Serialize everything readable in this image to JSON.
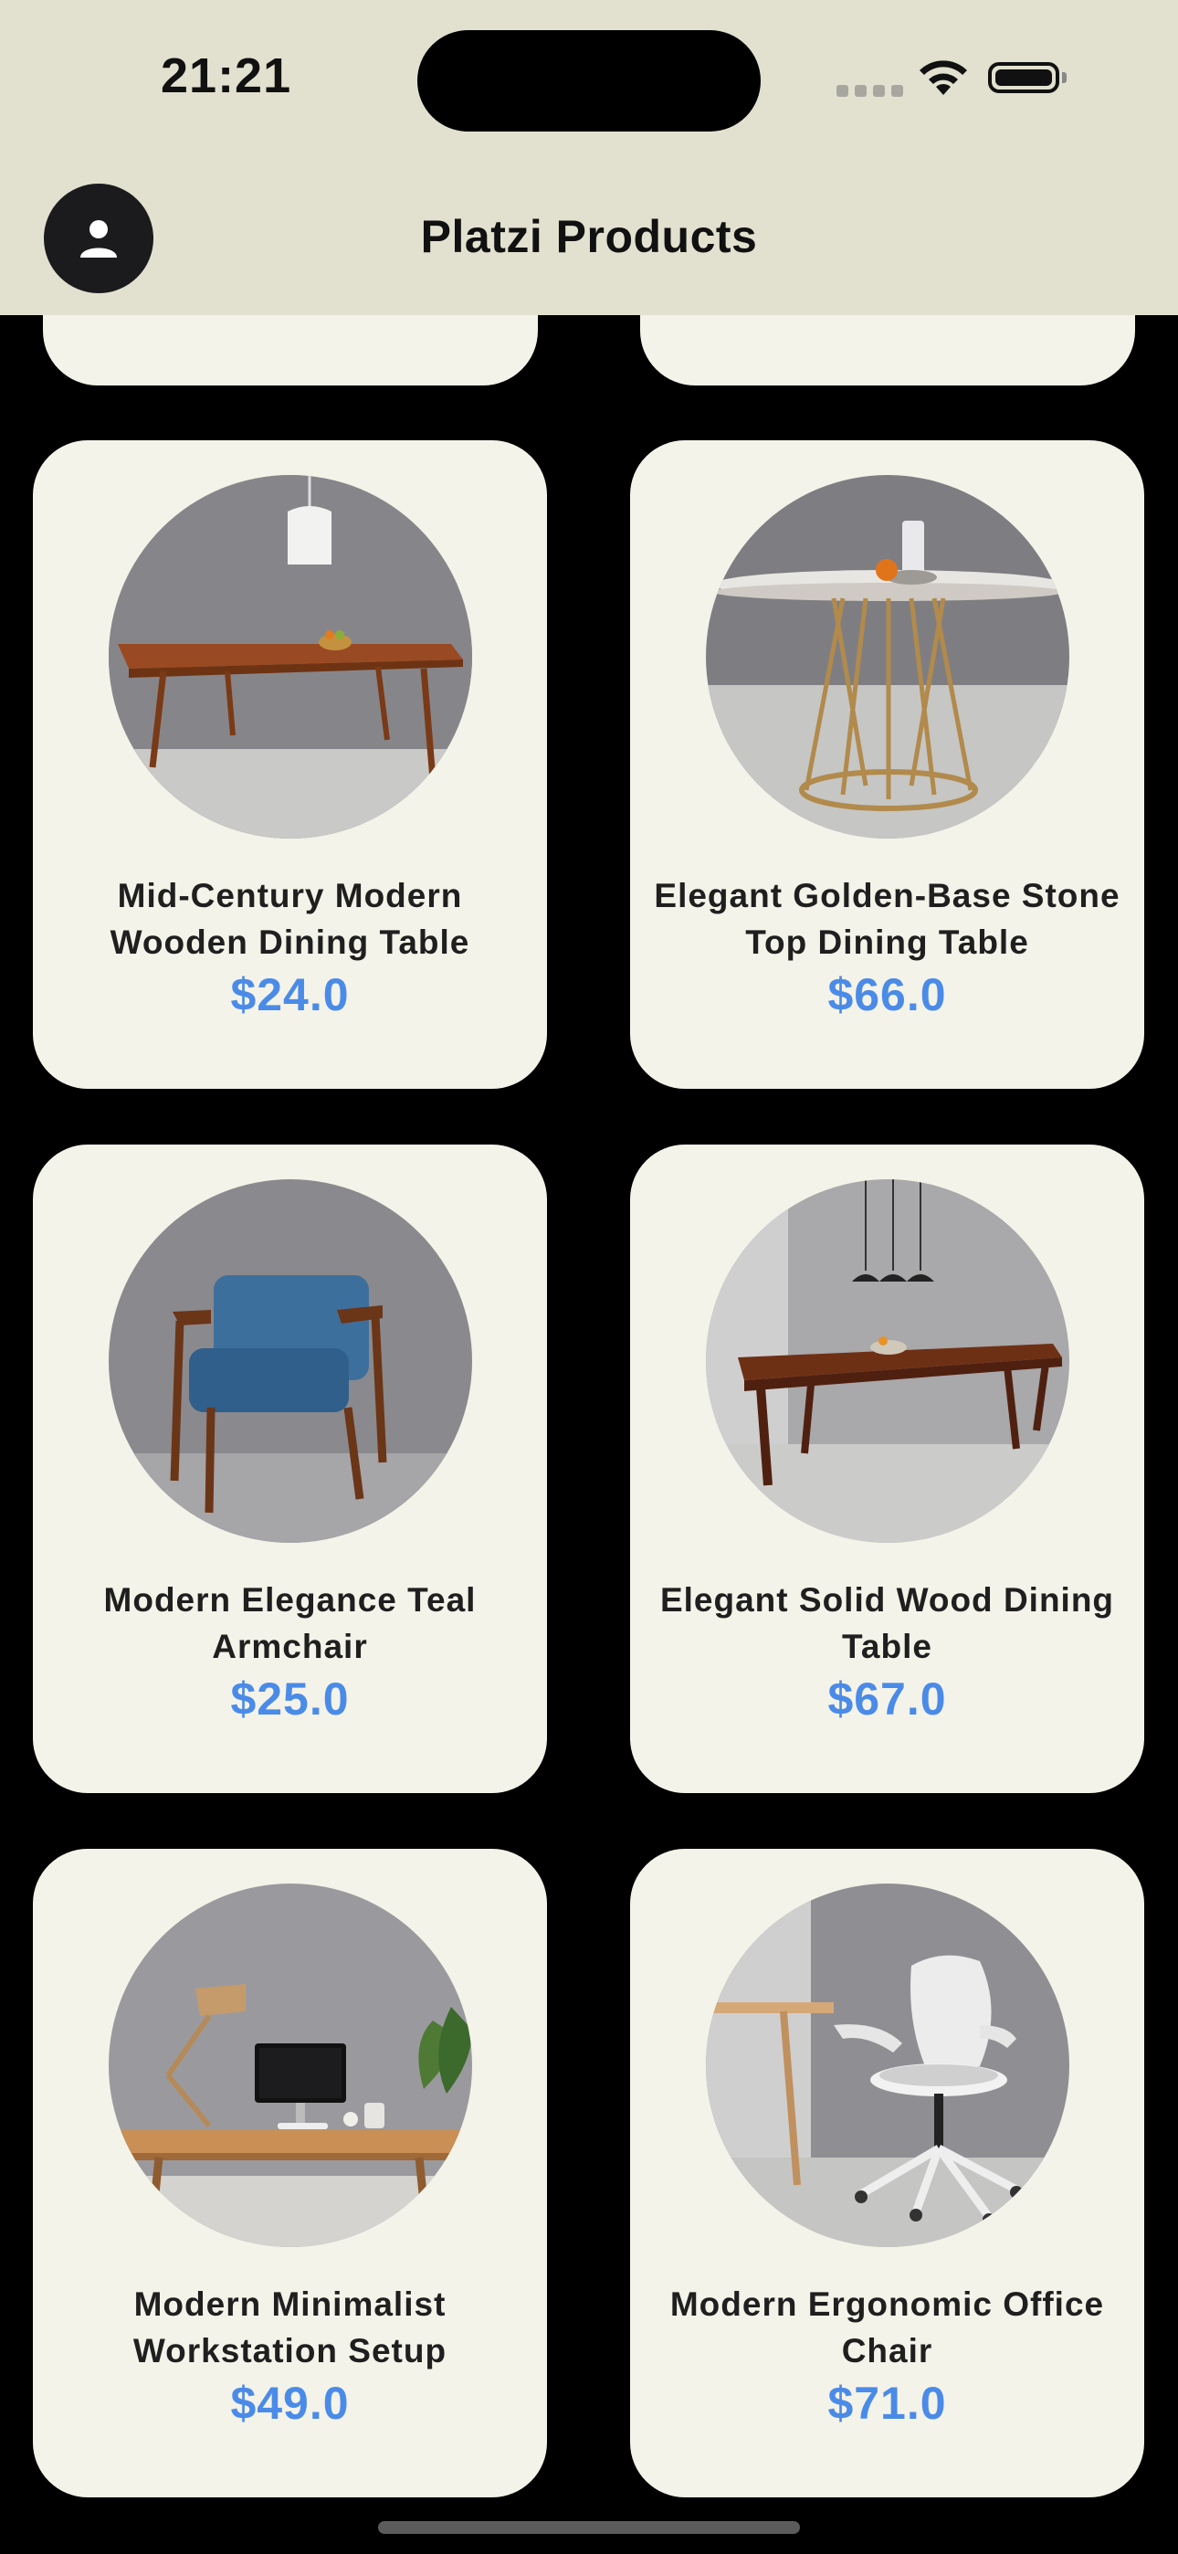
{
  "status_bar": {
    "time": "21:21"
  },
  "header": {
    "title": "Platzi Products"
  },
  "products": [
    {
      "name": "Mid-Century Modern Wooden Dining Table",
      "price": "$24.0",
      "image": "mid-century-dining-table-photo"
    },
    {
      "name": "Elegant Golden-Base Stone Top Dining Table",
      "price": "$66.0",
      "image": "golden-base-round-table-photo"
    },
    {
      "name": "Modern Elegance Teal Armchair",
      "price": "$25.0",
      "image": "teal-armchair-photo"
    },
    {
      "name": "Elegant Solid Wood Dining Table",
      "price": "$67.0",
      "image": "solid-wood-table-photo"
    },
    {
      "name": "Modern Minimalist Workstation Setup",
      "price": "$49.0",
      "image": "workstation-desk-photo"
    },
    {
      "name": "Modern Ergonomic Office Chair",
      "price": "$71.0",
      "image": "white-office-chair-photo"
    }
  ],
  "colors": {
    "header_bg": "#e2e1d0",
    "card_bg": "#f4f3e9",
    "price": "#4b8be8",
    "page_bg": "#000000"
  },
  "icons": [
    "person-icon",
    "wifi-icon",
    "battery-icon",
    "cellular-signal-icon"
  ]
}
